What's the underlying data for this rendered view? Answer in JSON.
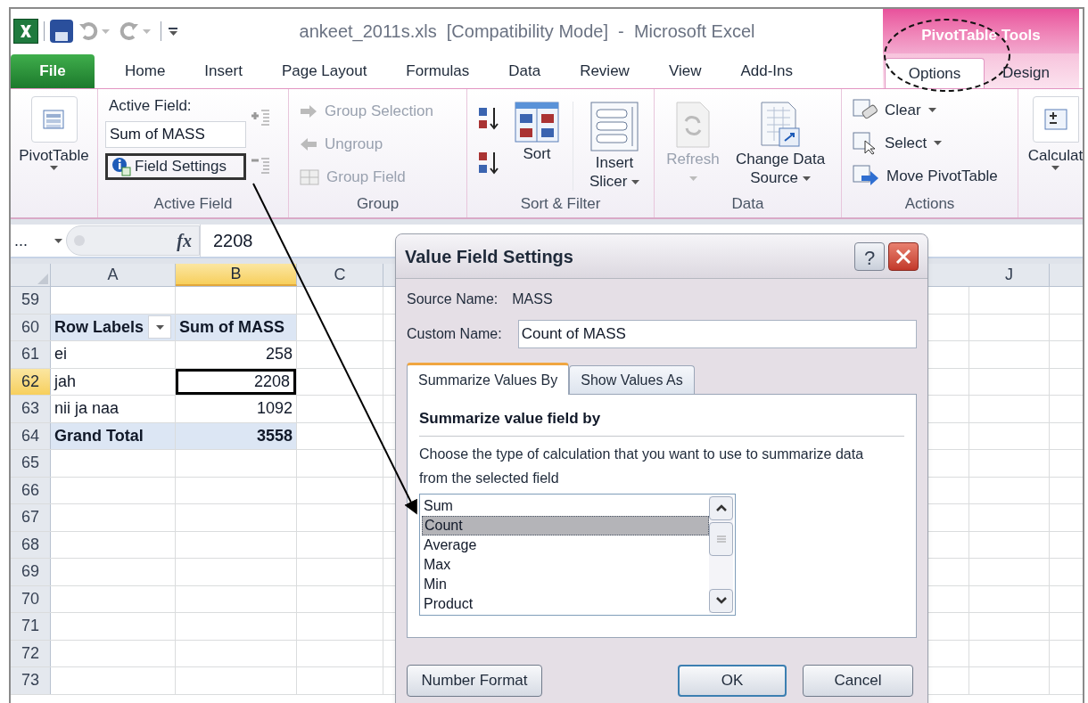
{
  "title_bar": {
    "title": "ankeet_2011s.xls  [Compatibility Mode]  -  Microsoft Excel",
    "context_label": "PivotTable Tools"
  },
  "tabs": [
    {
      "label": "File",
      "kind": "file",
      "selected": false
    },
    {
      "label": "Home",
      "kind": "tab",
      "selected": false
    },
    {
      "label": "Insert",
      "kind": "tab",
      "selected": false
    },
    {
      "label": "Page Layout",
      "kind": "tab",
      "selected": false
    },
    {
      "label": "Formulas",
      "kind": "tab",
      "selected": false
    },
    {
      "label": "Data",
      "kind": "tab",
      "selected": false
    },
    {
      "label": "Review",
      "kind": "tab",
      "selected": false
    },
    {
      "label": "View",
      "kind": "tab",
      "selected": false
    },
    {
      "label": "Add-Ins",
      "kind": "tab",
      "selected": false
    }
  ],
  "context_tabs": [
    {
      "label": "Options",
      "selected": true
    },
    {
      "label": "Design",
      "selected": false
    }
  ],
  "ribbon": [
    {
      "kind": "pivottable",
      "items": [
        {
          "label": "PivotTable",
          "dropdown": true,
          "disabled": false
        }
      ]
    },
    {
      "kind": "active_field",
      "title": "Active Field",
      "field_label": "Active Field:",
      "field_value": "Sum of MASS",
      "items": [
        {
          "label": "Field Settings",
          "highlighted": true
        }
      ]
    },
    {
      "kind": "group",
      "title": "Group",
      "items": [
        {
          "label": "Group Selection",
          "disabled": true
        },
        {
          "label": "Ungroup",
          "disabled": true
        },
        {
          "label": "Group Field",
          "disabled": true
        }
      ]
    },
    {
      "kind": "sort",
      "title": "Sort & Filter",
      "items": [
        {
          "label": "Sort",
          "dropdown": false,
          "disabled": false
        },
        {
          "label": "Insert Slicer",
          "dropdown": true,
          "disabled": false
        }
      ]
    },
    {
      "kind": "data",
      "title": "Data",
      "items": [
        {
          "label": "Refresh",
          "dropdown": true,
          "disabled": true
        },
        {
          "label": "Change Data Source",
          "dropdown": true,
          "disabled": false
        }
      ]
    },
    {
      "kind": "actions",
      "title": "Actions",
      "items": [
        {
          "label": "Clear",
          "dropdown": true
        },
        {
          "label": "Select",
          "dropdown": true
        },
        {
          "label": "Move PivotTable",
          "dropdown": false
        }
      ]
    },
    {
      "kind": "calc",
      "items": [
        {
          "label": "Calculat",
          "dropdown": true,
          "disabled": false
        }
      ]
    }
  ],
  "formula_bar": {
    "name_box": "...",
    "function_label": "fx",
    "formula": "2208"
  },
  "sheet": {
    "columns": [
      {
        "label": "A",
        "selected": false
      },
      {
        "label": "B",
        "selected": true
      },
      {
        "label": "C",
        "selected": false
      },
      {
        "label": "J",
        "selected": false
      }
    ],
    "rows": [
      {
        "number": "59",
        "kind": "blank",
        "selected": false
      },
      {
        "number": "60",
        "kind": "header",
        "selected": false,
        "cells": [
          "Row Labels",
          "Sum of MASS"
        ]
      },
      {
        "number": "61",
        "kind": "item",
        "selected": false,
        "cells": [
          "ei",
          "258"
        ]
      },
      {
        "number": "62",
        "kind": "item",
        "selected": true,
        "cells": [
          "jah",
          "2208"
        ]
      },
      {
        "number": "63",
        "kind": "item",
        "selected": false,
        "cells": [
          "nii ja naa",
          "1092"
        ]
      },
      {
        "number": "64",
        "kind": "total",
        "selected": false,
        "cells": [
          "Grand Total",
          "3558"
        ]
      },
      {
        "number": "65",
        "kind": "blank",
        "selected": false
      },
      {
        "number": "66",
        "kind": "blank",
        "selected": false
      },
      {
        "number": "67",
        "kind": "blank",
        "selected": false
      },
      {
        "number": "68",
        "kind": "blank",
        "selected": false
      },
      {
        "number": "69",
        "kind": "blank",
        "selected": false
      },
      {
        "number": "70",
        "kind": "blank",
        "selected": false
      },
      {
        "number": "71",
        "kind": "blank",
        "selected": false
      },
      {
        "number": "72",
        "kind": "blank",
        "selected": false
      },
      {
        "number": "73",
        "kind": "blank",
        "selected": false
      }
    ]
  },
  "dialog": {
    "title": "Value Field Settings",
    "help": "?",
    "source_label": "Source Name:",
    "source_value": "MASS",
    "custom_label": "Custom Name:",
    "custom_value": "Count of MASS",
    "tabs": [
      {
        "label": "Summarize Values By",
        "selected": true
      },
      {
        "label": "Show Values As",
        "selected": false
      }
    ],
    "section_title": "Summarize value field by",
    "description": "Choose the type of calculation that you want to use to summarize data from the selected field",
    "options": [
      {
        "label": "Sum",
        "selected": false
      },
      {
        "label": "Count",
        "selected": true
      },
      {
        "label": "Average",
        "selected": false
      },
      {
        "label": "Max",
        "selected": false
      },
      {
        "label": "Min",
        "selected": false
      },
      {
        "label": "Product",
        "selected": false
      }
    ],
    "buttons": [
      {
        "label": "Number Format",
        "kind": "secondary"
      },
      {
        "label": "OK",
        "kind": "default"
      },
      {
        "label": "Cancel",
        "kind": "cancel"
      }
    ]
  }
}
